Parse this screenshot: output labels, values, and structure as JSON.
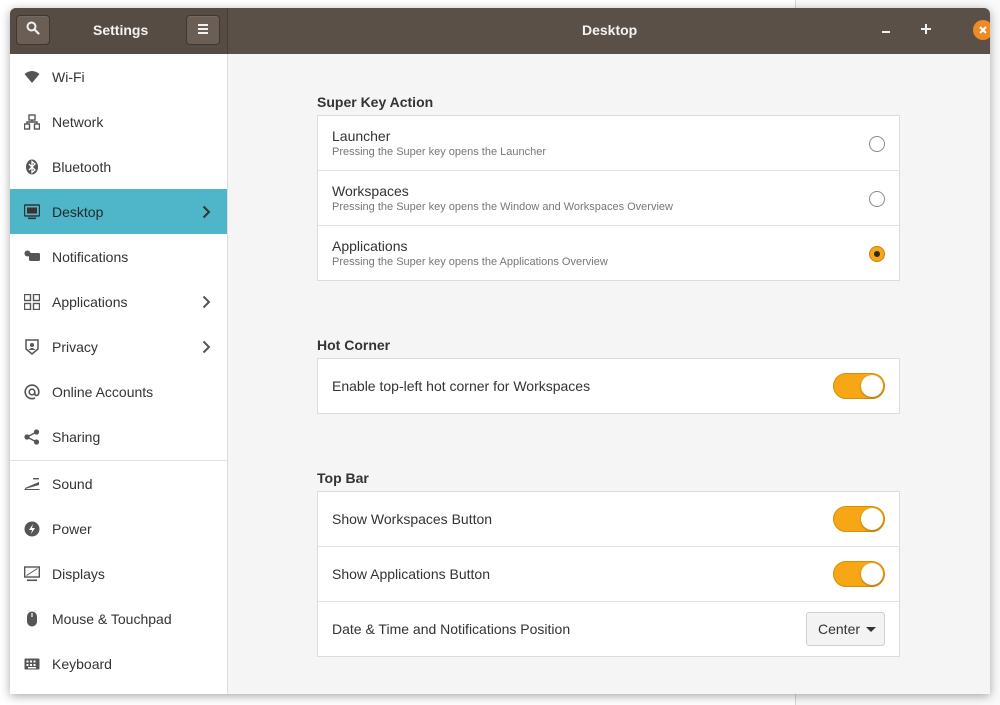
{
  "sidebar_header": {
    "title": "Settings",
    "search_icon": "search-icon",
    "menu_icon": "menu-icon"
  },
  "header": {
    "title": "Desktop"
  },
  "window_controls": {
    "minimize": "–",
    "maximize": "+",
    "close": "×"
  },
  "sidebar": {
    "items": [
      {
        "label": "Wi-Fi",
        "icon": "wifi-icon"
      },
      {
        "label": "Network",
        "icon": "network-icon"
      },
      {
        "label": "Bluetooth",
        "icon": "bluetooth-icon"
      },
      {
        "label": "Desktop",
        "icon": "desktop-icon",
        "active": true
      },
      {
        "label": "Notifications",
        "icon": "notifications-icon"
      },
      {
        "label": "Applications",
        "icon": "applications-icon"
      },
      {
        "label": "Privacy",
        "icon": "privacy-icon"
      },
      {
        "label": "Online Accounts",
        "icon": "at-icon"
      },
      {
        "label": "Sharing",
        "icon": "share-icon"
      },
      {
        "label": "Sound",
        "icon": "sound-icon"
      },
      {
        "label": "Power",
        "icon": "power-icon"
      },
      {
        "label": "Displays",
        "icon": "displays-icon"
      },
      {
        "label": "Mouse & Touchpad",
        "icon": "mouse-icon"
      },
      {
        "label": "Keyboard",
        "icon": "keyboard-icon"
      }
    ]
  },
  "super_key": {
    "heading": "Super Key Action",
    "options": [
      {
        "title": "Launcher",
        "desc": "Pressing the Super key opens the Launcher",
        "selected": false
      },
      {
        "title": "Workspaces",
        "desc": "Pressing the Super key opens the Window and Workspaces Overview",
        "selected": false
      },
      {
        "title": "Applications",
        "desc": "Pressing the Super key opens the Applications Overview",
        "selected": true
      }
    ]
  },
  "hot_corner": {
    "heading": "Hot Corner",
    "label": "Enable top-left hot corner for Workspaces",
    "enabled": true
  },
  "top_bar": {
    "heading": "Top Bar",
    "workspaces_label": "Show Workspaces Button",
    "workspaces_enabled": true,
    "applications_label": "Show Applications Button",
    "applications_enabled": true,
    "position_label": "Date & Time and Notifications Position",
    "position_value": "Center"
  },
  "colors": {
    "accent": "#f7a715",
    "selection": "#4fb5c8",
    "titlebar": "#5b5048",
    "close": "#f08a24"
  }
}
